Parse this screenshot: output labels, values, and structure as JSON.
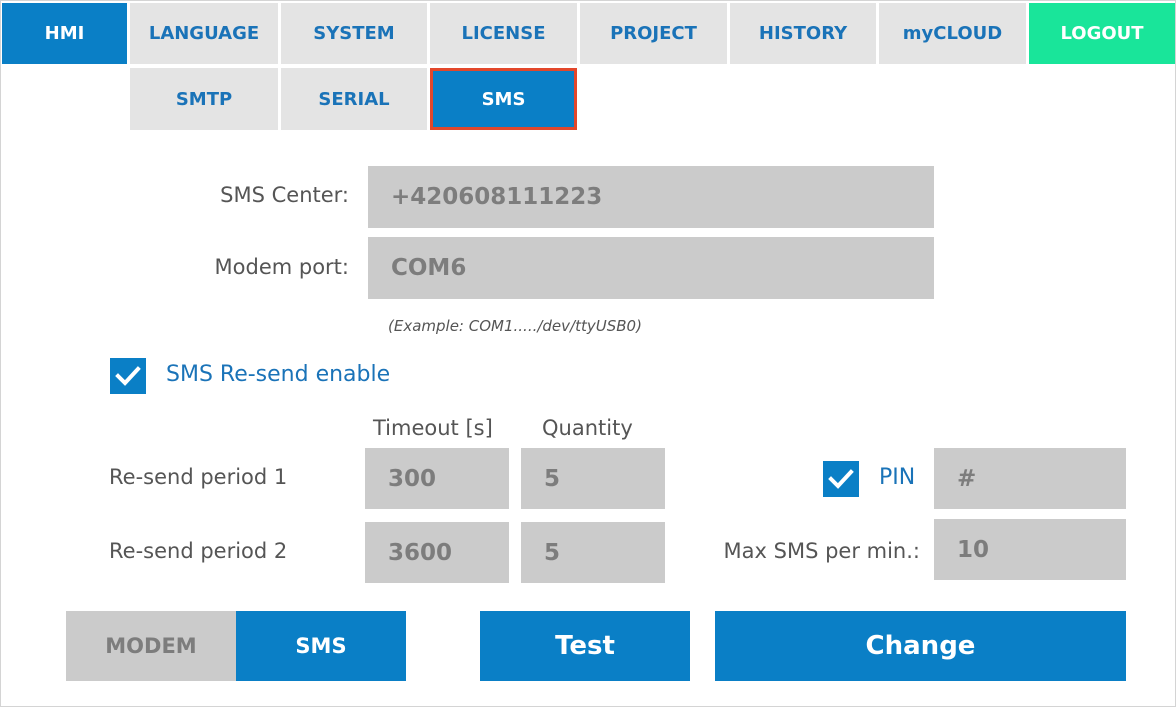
{
  "nav": {
    "tabs": [
      {
        "id": "hmi",
        "label": "HMI"
      },
      {
        "id": "language",
        "label": "LANGUAGE"
      },
      {
        "id": "system",
        "label": "SYSTEM"
      },
      {
        "id": "license",
        "label": "LICENSE"
      },
      {
        "id": "project",
        "label": "PROJECT"
      },
      {
        "id": "history",
        "label": "HISTORY"
      },
      {
        "id": "mycloud",
        "label": "myCLOUD"
      },
      {
        "id": "logout",
        "label": "LOGOUT"
      }
    ],
    "active_tab": "HMI",
    "subtabs": [
      {
        "id": "smtp",
        "label": "SMTP"
      },
      {
        "id": "serial",
        "label": "SERIAL"
      },
      {
        "id": "sms",
        "label": "SMS"
      }
    ],
    "active_subtab": "SMS"
  },
  "form": {
    "sms_center_label": "SMS Center:",
    "sms_center_value": "+420608111223",
    "modem_port_label": "Modem port:",
    "modem_port_value": "COM6",
    "modem_port_hint": "(Example: COM1...../dev/ttyUSB0)",
    "resend_enable_label": "SMS Re-send enable",
    "resend_enable_checked": true,
    "timeout_header": "Timeout [s]",
    "quantity_header": "Quantity",
    "periods": [
      {
        "label": "Re-send period 1",
        "timeout": "300",
        "quantity": "5"
      },
      {
        "label": "Re-send period 2",
        "timeout": "3600",
        "quantity": "5"
      }
    ],
    "pin_label": "PIN",
    "pin_checked": true,
    "pin_value": "#",
    "max_sms_label": "Max SMS per min.:",
    "max_sms_value": "10"
  },
  "footer": {
    "mode_modem_label": "MODEM",
    "mode_sms_label": "SMS",
    "active_mode": "SMS",
    "test_label": "Test",
    "change_label": "Change"
  },
  "colors": {
    "accent": "#0a7fc6",
    "logout": "#19e59a",
    "selected_border": "#e2472b",
    "tab_inactive": "#e4e4e4",
    "field_bg": "#cbcbcb"
  }
}
